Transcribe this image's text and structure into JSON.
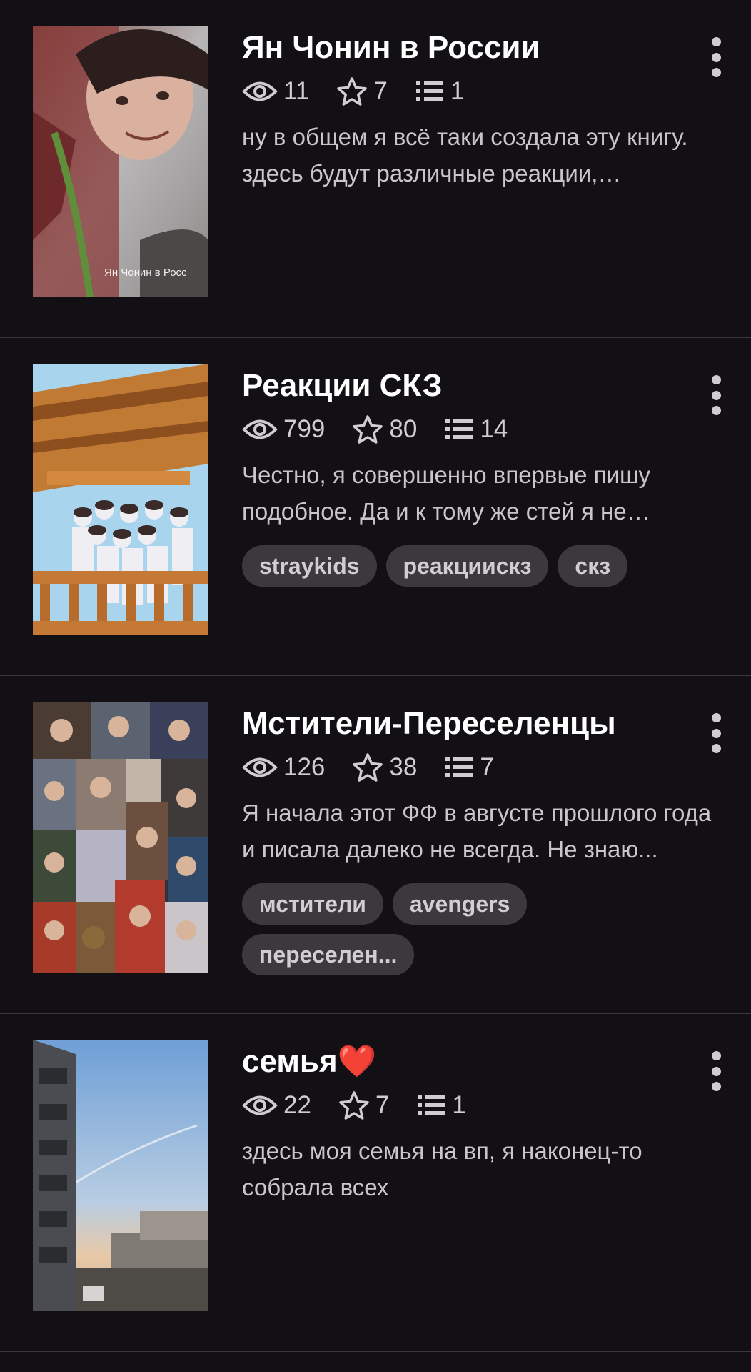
{
  "stories": [
    {
      "title": "Ян Чонин в России",
      "views": "11",
      "votes": "7",
      "parts": "1",
      "description": "ну в общем я всё таки создала эту книгу. здесь будут различные реакции, имейджины и т.д.",
      "tags": [],
      "cover": {
        "caption": "Ян Чонин в Росс"
      }
    },
    {
      "title": "Реакции СКЗ",
      "views": "799",
      "votes": "80",
      "parts": "14",
      "description": "Честно, я совершенно впервые пишу подобное. Да и к тому же стей я не являюсь уже давно...",
      "tags": [
        "straykids",
        "реакциискз",
        "скз"
      ]
    },
    {
      "title": "Мстители-Переселенцы",
      "views": "126",
      "votes": "38",
      "parts": "7",
      "description": "Я начала этот ФФ в августе прошлого года и писала далеко не всегда. Не знаю...",
      "tags": [
        "мстители",
        "avengers",
        "переселен..."
      ]
    },
    {
      "title": "семья❤️",
      "views": "22",
      "votes": "7",
      "parts": "1",
      "description": "здесь моя семья на вп, я наконец-то собрала всех",
      "tags": []
    }
  ],
  "colors": {
    "background": "#121014",
    "divider": "#3a383c",
    "tag_bg": "#3b393e",
    "secondary_text": "#c8c6cb"
  },
  "icons": {
    "views": "eye-icon",
    "votes": "star-icon",
    "parts": "list-icon",
    "menu": "more-vertical-icon"
  }
}
